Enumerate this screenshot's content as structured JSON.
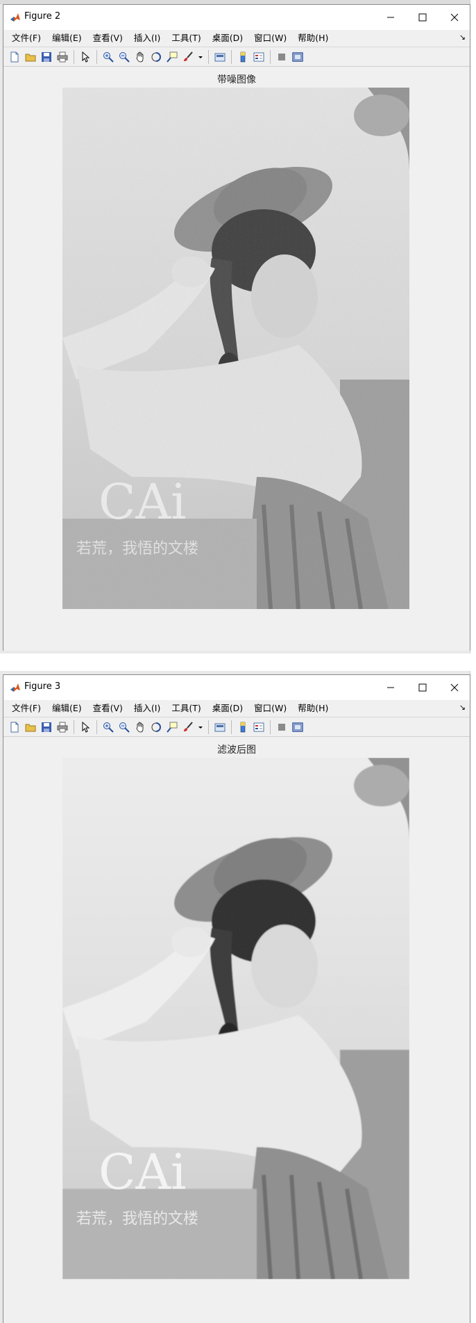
{
  "menu": [
    "文件(F)",
    "编辑(E)",
    "查看(V)",
    "插入(I)",
    "工具(T)",
    "桌面(D)",
    "窗口(W)",
    "帮助(H)"
  ],
  "windows": [
    {
      "title": "Figure 2",
      "axes_title": "带噪图像",
      "watermark": {
        "big": "CAi",
        "small": "若荒，我悟的文楼"
      }
    },
    {
      "title": "Figure 3",
      "axes_title": "滤波后图",
      "watermark": {
        "big": "CAi",
        "small": "若荒，我悟的文楼"
      }
    }
  ],
  "toolbar_icons": [
    "new-figure-icon",
    "open-file-icon",
    "save-icon",
    "print-icon",
    "pointer-icon",
    "zoom-in-icon",
    "zoom-out-icon",
    "pan-icon",
    "rotate-3d-icon",
    "data-cursor-icon",
    "brush-icon",
    "link-plot-icon",
    "colorbar-icon",
    "legend-icon",
    "hide-plot-tools-icon",
    "show-plot-tools-icon"
  ],
  "colors": {
    "window_bg": "#f0f0f0",
    "titlebar_bg": "#ffffff",
    "accent": "#d95319"
  }
}
